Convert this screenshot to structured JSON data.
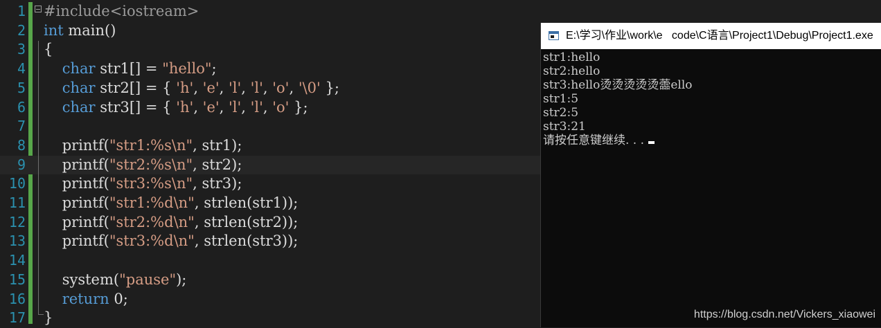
{
  "editor": {
    "lines": [
      {
        "no": "1",
        "tokens": [
          {
            "t": "pre",
            "v": "#include<iostream>"
          }
        ]
      },
      {
        "no": "2",
        "tokens": [
          {
            "t": "kw",
            "v": "int"
          },
          {
            "t": "plain",
            "v": " main()"
          }
        ]
      },
      {
        "no": "3",
        "tokens": [
          {
            "t": "plain",
            "v": "{"
          }
        ]
      },
      {
        "no": "4",
        "tokens": [
          {
            "t": "plain",
            "v": "    "
          },
          {
            "t": "kw",
            "v": "char"
          },
          {
            "t": "plain",
            "v": " str1[] = "
          },
          {
            "t": "str",
            "v": "\"hello\""
          },
          {
            "t": "plain",
            "v": ";"
          }
        ]
      },
      {
        "no": "5",
        "tokens": [
          {
            "t": "plain",
            "v": "    "
          },
          {
            "t": "kw",
            "v": "char"
          },
          {
            "t": "plain",
            "v": " str2[] = { "
          },
          {
            "t": "str",
            "v": "'h'"
          },
          {
            "t": "plain",
            "v": ", "
          },
          {
            "t": "str",
            "v": "'e'"
          },
          {
            "t": "plain",
            "v": ", "
          },
          {
            "t": "str",
            "v": "'l'"
          },
          {
            "t": "plain",
            "v": ", "
          },
          {
            "t": "str",
            "v": "'l'"
          },
          {
            "t": "plain",
            "v": ", "
          },
          {
            "t": "str",
            "v": "'o'"
          },
          {
            "t": "plain",
            "v": ", "
          },
          {
            "t": "str",
            "v": "'\\0'"
          },
          {
            "t": "plain",
            "v": " };"
          }
        ]
      },
      {
        "no": "6",
        "tokens": [
          {
            "t": "plain",
            "v": "    "
          },
          {
            "t": "kw",
            "v": "char"
          },
          {
            "t": "plain",
            "v": " str3[] = { "
          },
          {
            "t": "str",
            "v": "'h'"
          },
          {
            "t": "plain",
            "v": ", "
          },
          {
            "t": "str",
            "v": "'e'"
          },
          {
            "t": "plain",
            "v": ", "
          },
          {
            "t": "str",
            "v": "'l'"
          },
          {
            "t": "plain",
            "v": ", "
          },
          {
            "t": "str",
            "v": "'l'"
          },
          {
            "t": "plain",
            "v": ", "
          },
          {
            "t": "str",
            "v": "'o'"
          },
          {
            "t": "plain",
            "v": " };"
          }
        ]
      },
      {
        "no": "7",
        "tokens": []
      },
      {
        "no": "8",
        "tokens": [
          {
            "t": "plain",
            "v": "    printf("
          },
          {
            "t": "str",
            "v": "\"str1:%s\\n\""
          },
          {
            "t": "plain",
            "v": ", str1);"
          }
        ]
      },
      {
        "no": "9",
        "current": true,
        "tokens": [
          {
            "t": "plain",
            "v": "    printf("
          },
          {
            "t": "str",
            "v": "\"str2:%s\\n\""
          },
          {
            "t": "plain",
            "v": ", str2);"
          }
        ]
      },
      {
        "no": "10",
        "tokens": [
          {
            "t": "plain",
            "v": "    printf("
          },
          {
            "t": "str",
            "v": "\"str3:%s\\n\""
          },
          {
            "t": "plain",
            "v": ", str3);"
          }
        ]
      },
      {
        "no": "11",
        "tokens": [
          {
            "t": "plain",
            "v": "    printf("
          },
          {
            "t": "str",
            "v": "\"str1:%d\\n\""
          },
          {
            "t": "plain",
            "v": ", strlen(str1));"
          }
        ]
      },
      {
        "no": "12",
        "tokens": [
          {
            "t": "plain",
            "v": "    printf("
          },
          {
            "t": "str",
            "v": "\"str2:%d\\n\""
          },
          {
            "t": "plain",
            "v": ", strlen(str2));"
          }
        ]
      },
      {
        "no": "13",
        "tokens": [
          {
            "t": "plain",
            "v": "    printf("
          },
          {
            "t": "str",
            "v": "\"str3:%d\\n\""
          },
          {
            "t": "plain",
            "v": ", strlen(str3));"
          }
        ]
      },
      {
        "no": "14",
        "tokens": []
      },
      {
        "no": "15",
        "tokens": [
          {
            "t": "plain",
            "v": "    system("
          },
          {
            "t": "str",
            "v": "\"pause\""
          },
          {
            "t": "plain",
            "v": ");"
          }
        ]
      },
      {
        "no": "16",
        "tokens": [
          {
            "t": "plain",
            "v": "    "
          },
          {
            "t": "kw",
            "v": "return"
          },
          {
            "t": "plain",
            "v": " 0;"
          }
        ]
      },
      {
        "no": "17",
        "tokens": [
          {
            "t": "plain",
            "v": "}"
          }
        ]
      }
    ]
  },
  "console": {
    "title": "E:\\学习\\作业\\work\\e   code\\C语言\\Project1\\Debug\\Project1.exe",
    "output": [
      "str1:hello",
      "str2:hello",
      "str3:hello烫烫烫烫烫蘦ello",
      "str1:5",
      "str2:5",
      "str3:21",
      "请按任意键继续. . ."
    ]
  },
  "watermark": "https://blog.csdn.net/Vickers_xiaowei",
  "colors": {
    "editor_bg": "#1e1e1e",
    "keyword": "#569cd6",
    "string": "#d69d85",
    "preprocessor": "#9b9b9b",
    "line_number": "#2b91af",
    "change_bar": "#57a64a",
    "console_bg": "#0c0c0c"
  }
}
